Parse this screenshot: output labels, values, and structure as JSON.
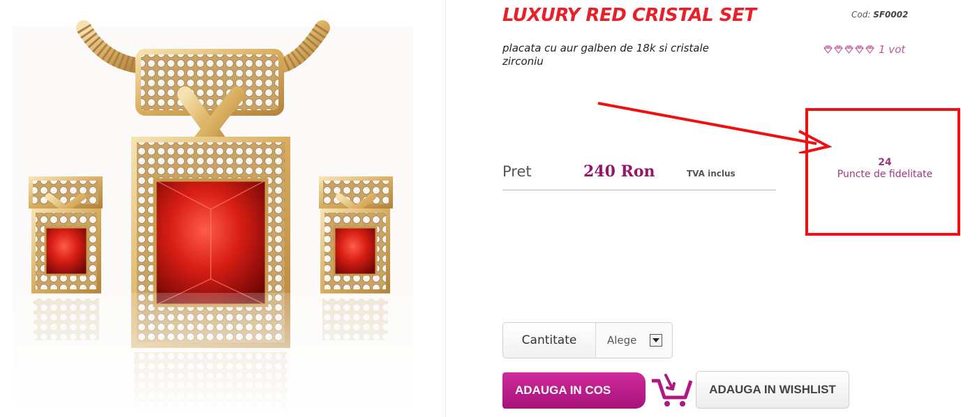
{
  "product": {
    "title": "LUXURY RED CRISTAL SET",
    "code_label": "Cod:",
    "code_value": "SF0002",
    "subtitle": "placata cu aur galben de 18k si cristale zirconiu",
    "rating_count": "1 vot",
    "rating_icons": "diamond-icon",
    "image_alt": "gold jewelry set with red crystals"
  },
  "loyalty": {
    "points": "24",
    "label": "Puncte de fidelitate"
  },
  "price": {
    "label": "Pret",
    "value": "240 Ron",
    "vat": "TVA inclus"
  },
  "quantity": {
    "label": "Cantitate",
    "selected": "Alege"
  },
  "actions": {
    "add_to_cart": "ADAUGA IN COS",
    "add_to_wishlist": "ADAUGA IN WISHLIST"
  },
  "colors": {
    "title": "#e8202a",
    "accent": "#a6127a",
    "annotation": "#ee1111"
  }
}
